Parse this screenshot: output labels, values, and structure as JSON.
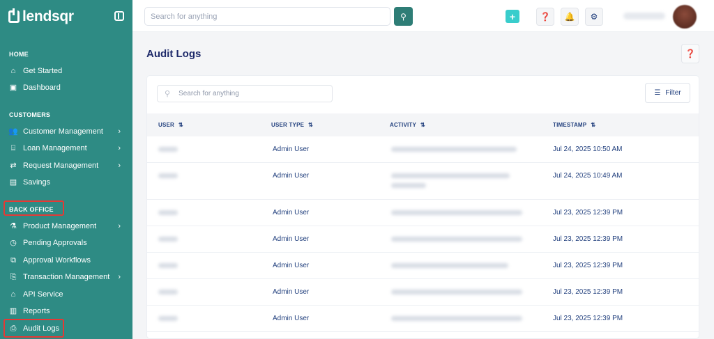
{
  "brand": {
    "name": "lendsqr"
  },
  "sidebar": {
    "sections": {
      "home": "HOME",
      "customers": "CUSTOMERS",
      "back_office": "BACK OFFICE"
    },
    "items": {
      "get_started": "Get Started",
      "dashboard": "Dashboard",
      "customer_management": "Customer Management",
      "loan_management": "Loan Management",
      "request_management": "Request Management",
      "savings": "Savings",
      "product_management": "Product Management",
      "pending_approvals": "Pending Approvals",
      "approval_workflows": "Approval Workflows",
      "transaction_management": "Transaction Management",
      "api_service": "API Service",
      "reports": "Reports",
      "audit_logs": "Audit Logs"
    },
    "highlight_color": "#e53935"
  },
  "topbar": {
    "search_placeholder": "Search for anything"
  },
  "page": {
    "title": "Audit Logs",
    "search_placeholder": "Search for anything",
    "filter_label": "Filter"
  },
  "table": {
    "columns": [
      "USER",
      "USER TYPE",
      "ACTIVITY",
      "TIMESTAMP"
    ],
    "rows": [
      {
        "user_type": "Admin User",
        "timestamp": "Jul 24, 2025 10:50 AM"
      },
      {
        "user_type": "Admin User",
        "timestamp": "Jul 24, 2025 10:49 AM"
      },
      {
        "user_type": "Admin User",
        "timestamp": "Jul 23, 2025 12:39 PM"
      },
      {
        "user_type": "Admin User",
        "timestamp": "Jul 23, 2025 12:39 PM"
      },
      {
        "user_type": "Admin User",
        "timestamp": "Jul 23, 2025 12:39 PM"
      },
      {
        "user_type": "Admin User",
        "timestamp": "Jul 23, 2025 12:39 PM"
      },
      {
        "user_type": "Admin User",
        "timestamp": "Jul 23, 2025 12:39 PM"
      }
    ]
  },
  "colors": {
    "sidebar_bg": "#2e8b84",
    "accent": "#39cdcc",
    "title": "#1e2a6a"
  }
}
